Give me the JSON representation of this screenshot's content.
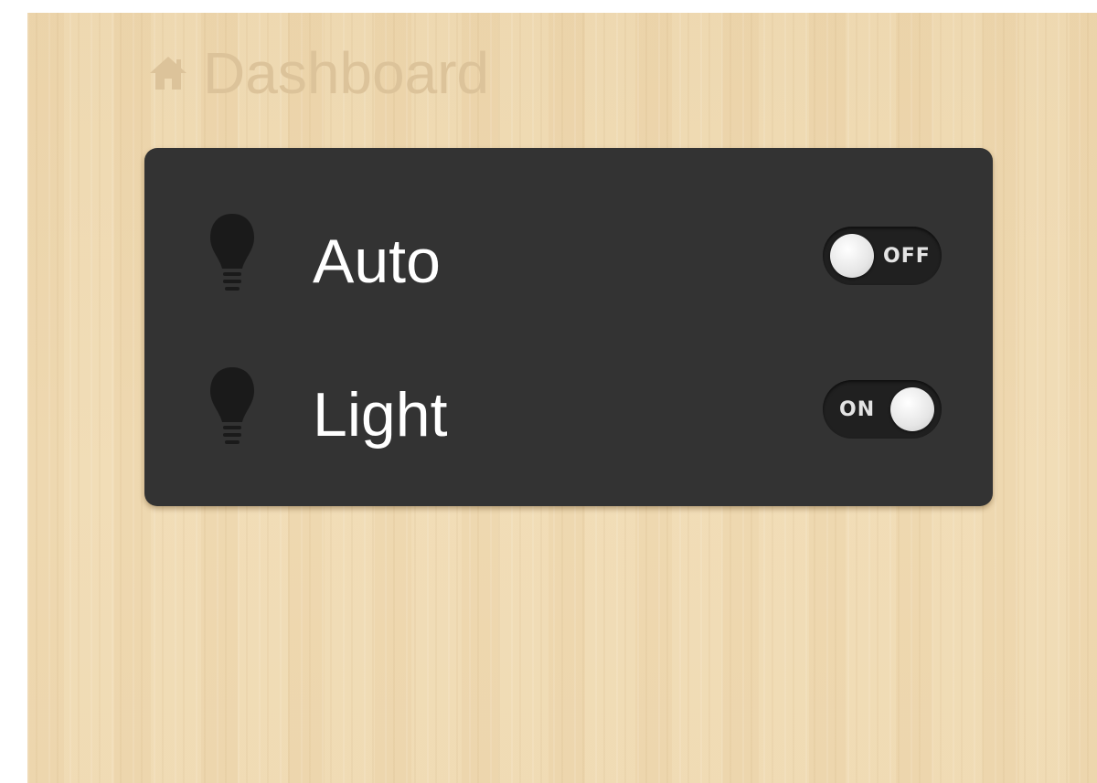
{
  "header": {
    "title": "Dashboard",
    "icon": "home-icon"
  },
  "colors": {
    "background_wood": "#ecd5ab",
    "panel": "#333333",
    "title_text": "#dcc39a",
    "label_text": "#ffffff",
    "toggle_track": "#202020"
  },
  "controls": [
    {
      "label": "Auto",
      "icon": "lightbulb-icon",
      "toggle_state": "off",
      "toggle_text": "OFF"
    },
    {
      "label": "Light",
      "icon": "lightbulb-icon",
      "toggle_state": "on",
      "toggle_text": "ON"
    }
  ]
}
